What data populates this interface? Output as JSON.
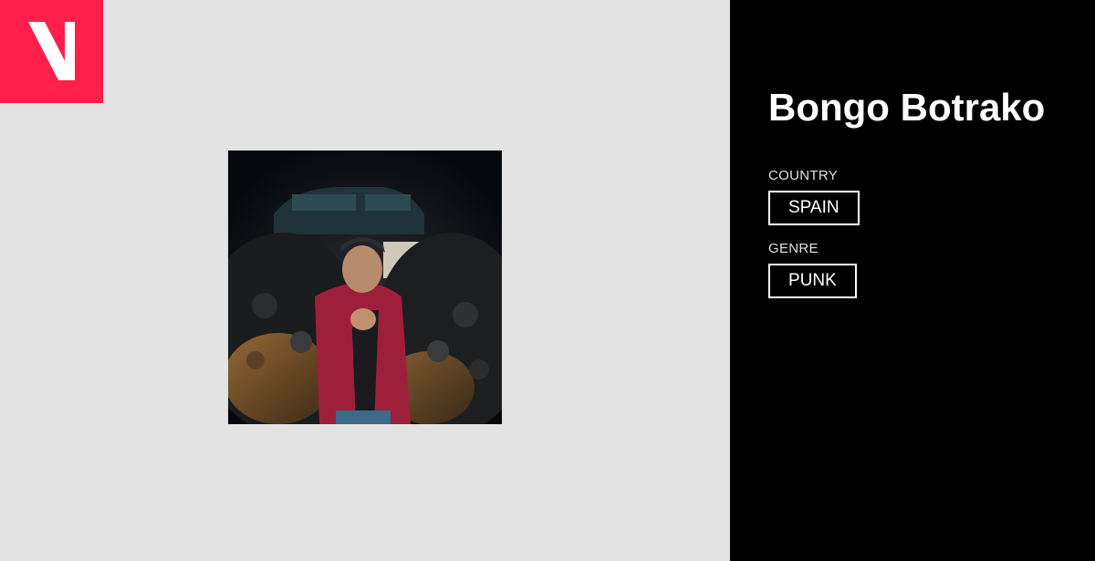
{
  "logo": {
    "icon": "v-logo-icon",
    "color": "#ff1f4b"
  },
  "photo": {
    "subject": "artist-photo"
  },
  "artist": {
    "name": "Bongo Botrako",
    "country_label": "COUNTRY",
    "country_value": "SPAIN",
    "genre_label": "GENRE",
    "genre_value": "PUNK"
  },
  "colors": {
    "background_left": "#e3e3e3",
    "background_right": "#000000",
    "accent": "#ff1f4b"
  }
}
